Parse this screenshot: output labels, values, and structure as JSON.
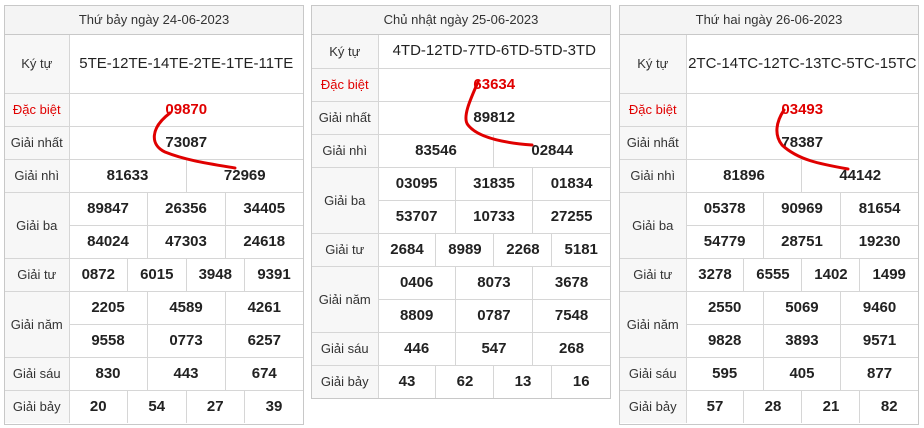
{
  "panels": [
    {
      "title": "Thứ bảy ngày 24-06-2023",
      "ky_tu": "5TE-12TE-14TE-2TE-1TE-11TE",
      "dac_biet": "09870",
      "giai_nhat": "73087",
      "giai_nhi": [
        "81633",
        "72969"
      ],
      "giai_ba": [
        "89847",
        "26356",
        "34405",
        "84024",
        "47303",
        "24618"
      ],
      "giai_tu": [
        "0872",
        "6015",
        "3948",
        "9391"
      ],
      "giai_nam": [
        "2205",
        "4589",
        "4261",
        "9558",
        "0773",
        "6257"
      ],
      "giai_sau": [
        "830",
        "443",
        "674"
      ],
      "giai_bay": [
        "20",
        "54",
        "27",
        "39"
      ]
    },
    {
      "title": "Chủ nhật ngày 25-06-2023",
      "ky_tu": "4TD-12TD-7TD-6TD-5TD-3TD",
      "dac_biet": "63634",
      "giai_nhat": "89812",
      "giai_nhi": [
        "83546",
        "02844"
      ],
      "giai_ba": [
        "03095",
        "31835",
        "01834",
        "53707",
        "10733",
        "27255"
      ],
      "giai_tu": [
        "2684",
        "8989",
        "2268",
        "5181"
      ],
      "giai_nam": [
        "0406",
        "8073",
        "3678",
        "8809",
        "0787",
        "7548"
      ],
      "giai_sau": [
        "446",
        "547",
        "268"
      ],
      "giai_bay": [
        "43",
        "62",
        "13",
        "16"
      ]
    },
    {
      "title": "Thứ hai ngày 26-06-2023",
      "ky_tu": "2TC-14TC-12TC-13TC-5TC-15TC",
      "dac_biet": "03493",
      "giai_nhat": "78387",
      "giai_nhi": [
        "81896",
        "44142"
      ],
      "giai_ba": [
        "05378",
        "90969",
        "81654",
        "54779",
        "28751",
        "19230"
      ],
      "giai_tu": [
        "3278",
        "6555",
        "1402",
        "1499"
      ],
      "giai_nam": [
        "2550",
        "5069",
        "9460",
        "9828",
        "3893",
        "9571"
      ],
      "giai_sau": [
        "595",
        "405",
        "877"
      ],
      "giai_bay": [
        "57",
        "28",
        "21",
        "82"
      ]
    }
  ],
  "labels": {
    "ky_tu": "Ký tự",
    "dac_biet": "Đặc biệt",
    "giai_nhat": "Giải nhất",
    "giai_nhi": "Giải nhì",
    "giai_ba": "Giải ba",
    "giai_tu": "Giải tư",
    "giai_nam": "Giải năm",
    "giai_sau": "Giải sáu",
    "giai_bay": "Giải bảy"
  },
  "colors": {
    "special": "#e00000",
    "scribble": "#e00000",
    "label_bg": "#f7f7f7"
  }
}
